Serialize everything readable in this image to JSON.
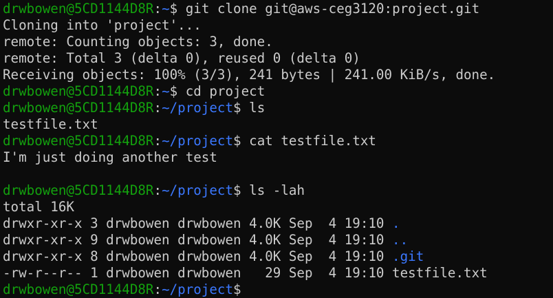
{
  "terminal": {
    "prompt_user": "drwbowen@5CD1144D8R",
    "colors": {
      "background": "#0c0c0c",
      "text": "#cccccc",
      "user": "#13a10e",
      "path": "#3b78ff"
    },
    "lines": [
      {
        "kind": "prompt",
        "path": "~",
        "command": "git clone git@aws-ceg3120:project.git"
      },
      {
        "kind": "output",
        "text": "Cloning into 'project'..."
      },
      {
        "kind": "output",
        "text": "remote: Counting objects: 3, done."
      },
      {
        "kind": "output",
        "text": "remote: Total 3 (delta 0), reused 0 (delta 0)"
      },
      {
        "kind": "output",
        "text": "Receiving objects: 100% (3/3), 241 bytes | 241.00 KiB/s, done."
      },
      {
        "kind": "prompt",
        "path": "~",
        "command": "cd project"
      },
      {
        "kind": "prompt",
        "path": "~/project",
        "command": "ls"
      },
      {
        "kind": "output",
        "text": "testfile.txt"
      },
      {
        "kind": "prompt",
        "path": "~/project",
        "command": "cat testfile.txt"
      },
      {
        "kind": "output",
        "text": "I'm just doing another test"
      },
      {
        "kind": "output",
        "text": ""
      },
      {
        "kind": "prompt",
        "path": "~/project",
        "command": "ls -lah"
      },
      {
        "kind": "output",
        "text": "total 16K"
      },
      {
        "kind": "listing",
        "prefix": "drwxr-xr-x 3 drwbowen drwbowen 4.0K Sep  4 19:10 ",
        "name": ".",
        "is_dir": true
      },
      {
        "kind": "listing",
        "prefix": "drwxr-xr-x 9 drwbowen drwbowen 4.0K Sep  4 19:10 ",
        "name": "..",
        "is_dir": true
      },
      {
        "kind": "listing",
        "prefix": "drwxr-xr-x 8 drwbowen drwbowen 4.0K Sep  4 19:10 ",
        "name": ".git",
        "is_dir": true
      },
      {
        "kind": "listing",
        "prefix": "-rw-r--r-- 1 drwbowen drwbowen   29 Sep  4 19:10 ",
        "name": "testfile.txt",
        "is_dir": false
      },
      {
        "kind": "prompt",
        "path": "~/project",
        "command": ""
      }
    ]
  }
}
